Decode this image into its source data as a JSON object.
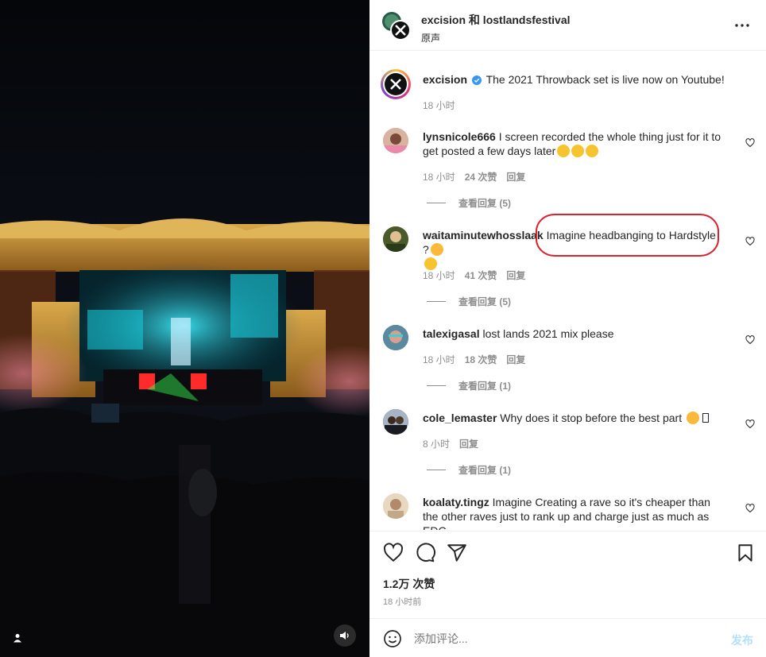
{
  "header": {
    "title": "excision 和 lostlandsfestival",
    "subtitle": "原声"
  },
  "caption": {
    "username": "excision",
    "text": "The 2021 Throwback set is live now on Youtube!",
    "time": "18 小时"
  },
  "comments": [
    {
      "username": "lynsnicole666",
      "text": "I screen recorded the whole thing just for it to get posted a few days later",
      "emojis": 3,
      "time": "18 小时",
      "likes": "24 次赞",
      "reply": "回复",
      "view_replies": "查看回复 (5)"
    },
    {
      "username": "waitaminutewhosslaak",
      "text": "Imagine headbanging to Hardstyle ?",
      "time": "18 小时",
      "likes": "41 次赞",
      "reply": "回复",
      "view_replies": "查看回复 (5)"
    },
    {
      "username": "talexigasal",
      "text": "lost lands 2021 mix please",
      "time": "18 小时",
      "likes": "18 次赞",
      "reply": "回复",
      "view_replies": "查看回复 (1)"
    },
    {
      "username": "cole_lemaster",
      "text": "Why does it stop before the best part",
      "time": "8 小时",
      "reply": "回复",
      "view_replies": "查看回复 (1)"
    },
    {
      "username": "koalaty.tingz",
      "text": "Imagine Creating a rave so it's cheaper than the other raves just to rank up and charge just as much as EDC"
    }
  ],
  "footer": {
    "likes": "1.2万 次赞",
    "posted": "18 小时前",
    "comment_placeholder": "添加评论...",
    "post_label": "发布"
  },
  "colors": {
    "highlight": "#d9232d",
    "verified": "#3897f0",
    "post_disabled": "#b2dffc",
    "muted": "#8e8e8e"
  }
}
